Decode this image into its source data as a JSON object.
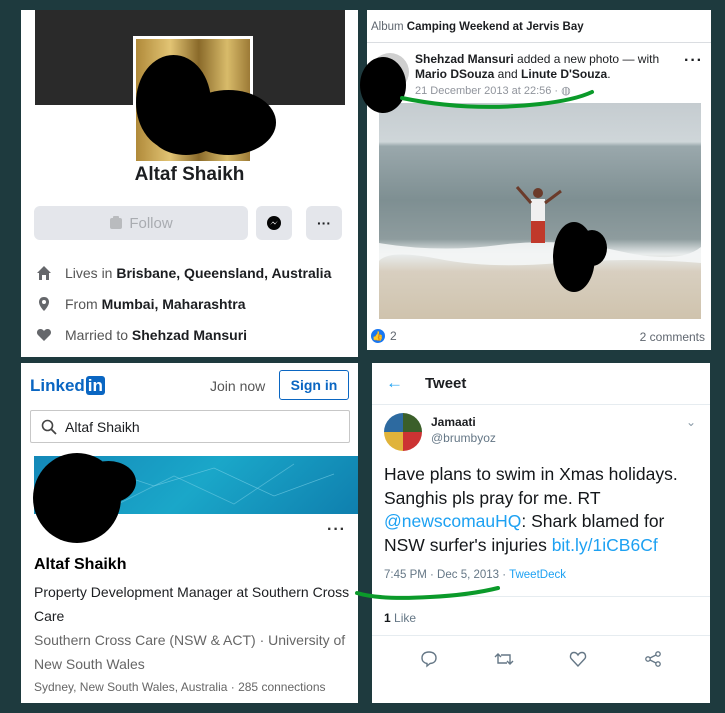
{
  "facebook_profile": {
    "name": "Altaf Shaikh",
    "follow_label": "Follow",
    "details": [
      {
        "icon": "home-icon",
        "prefix": "Lives in ",
        "value": "Brisbane, Queensland, Australia"
      },
      {
        "icon": "location-pin-icon",
        "prefix": "From ",
        "value": "Mumbai, Maharashtra"
      },
      {
        "icon": "heart-icon",
        "prefix": "Married to ",
        "value": "Shehzad Mansuri"
      }
    ]
  },
  "facebook_post": {
    "album_prefix": "Album ",
    "album_name": "Camping Weekend at Jervis Bay",
    "author": "Shehzad Mansuri",
    "action": " added a new photo — with ",
    "tagged_1": "Mario DSouza",
    "conj": " and ",
    "tagged_2": "Linute D'Souza",
    "end": ".",
    "timestamp": "21 December 2013 at 22:56 ·",
    "reactions": "2",
    "comments": "2 comments"
  },
  "linkedin": {
    "logo_text": "Linked",
    "logo_in": "in",
    "join_label": "Join now",
    "signin_label": "Sign in",
    "search_value": "Altaf Shaikh",
    "name": "Altaf Shaikh",
    "headline": "Property Development Manager at Southern Cross Care",
    "education": "Southern Cross Care (NSW & ACT) · University of New South Wales",
    "location": "Sydney, New South Wales, Australia · 285 connections"
  },
  "tweet": {
    "header": "Tweet",
    "display_name": "Jamaati",
    "handle": "@brumbyoz",
    "text_1": "Have plans to swim in Xmas holidays. Sanghis pls pray for me. RT ",
    "mention": "@newscomauHQ",
    "text_2": ": Shark blamed for NSW surfer's injuries ",
    "link": "bit.ly/1iCB6Cf",
    "time": "7:45 PM · Dec 5, 2013 · ",
    "source": "TweetDeck",
    "like_count": "1",
    "like_label": " Like"
  },
  "colors": {
    "background": "#1e3a3e",
    "facebook_blue": "#1877f2",
    "linkedin_blue": "#0a66c2",
    "twitter_blue": "#1da1f2",
    "annotation_green": "#0b9a2a"
  }
}
